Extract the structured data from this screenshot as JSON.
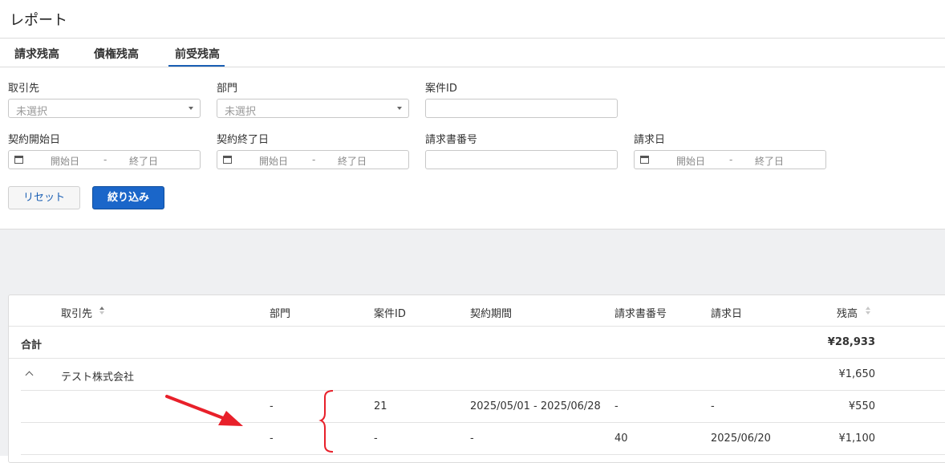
{
  "page": {
    "title": "レポート"
  },
  "tabs": [
    {
      "label": "請求残高"
    },
    {
      "label": "債権残高"
    },
    {
      "label": "前受残高"
    }
  ],
  "filters": {
    "client": {
      "label": "取引先",
      "value": "未選択"
    },
    "department": {
      "label": "部門",
      "value": "未選択"
    },
    "case_id": {
      "label": "案件ID",
      "value": ""
    },
    "contract_start": {
      "label": "契約開始日",
      "from_placeholder": "開始日",
      "separator": "-",
      "to_placeholder": "終了日"
    },
    "contract_end": {
      "label": "契約終了日",
      "from_placeholder": "開始日",
      "separator": "-",
      "to_placeholder": "終了日"
    },
    "invoice_number": {
      "label": "請求書番号",
      "value": ""
    },
    "invoice_date": {
      "label": "請求日",
      "from_placeholder": "開始日",
      "separator": "-",
      "to_placeholder": "終了日"
    }
  },
  "buttons": {
    "reset": "リセット",
    "filter": "絞り込み"
  },
  "table": {
    "columns": [
      "取引先",
      "部門",
      "案件ID",
      "契約期間",
      "請求書番号",
      "請求日",
      "残高"
    ],
    "total": {
      "label": "合計",
      "balance": "¥28,933"
    },
    "group": {
      "client": "テスト株式会社",
      "balance": "¥1,650"
    },
    "rows": [
      {
        "department": "-",
        "case_id": "21",
        "period": "2025/05/01 - 2025/06/28",
        "invoice_number": "-",
        "invoice_date": "-",
        "balance": "¥550"
      },
      {
        "department": "-",
        "case_id": "-",
        "period": "-",
        "invoice_number": "40",
        "invoice_date": "2025/06/20",
        "balance": "¥1,100"
      }
    ]
  },
  "annotation": {
    "color": "#e8202a"
  }
}
